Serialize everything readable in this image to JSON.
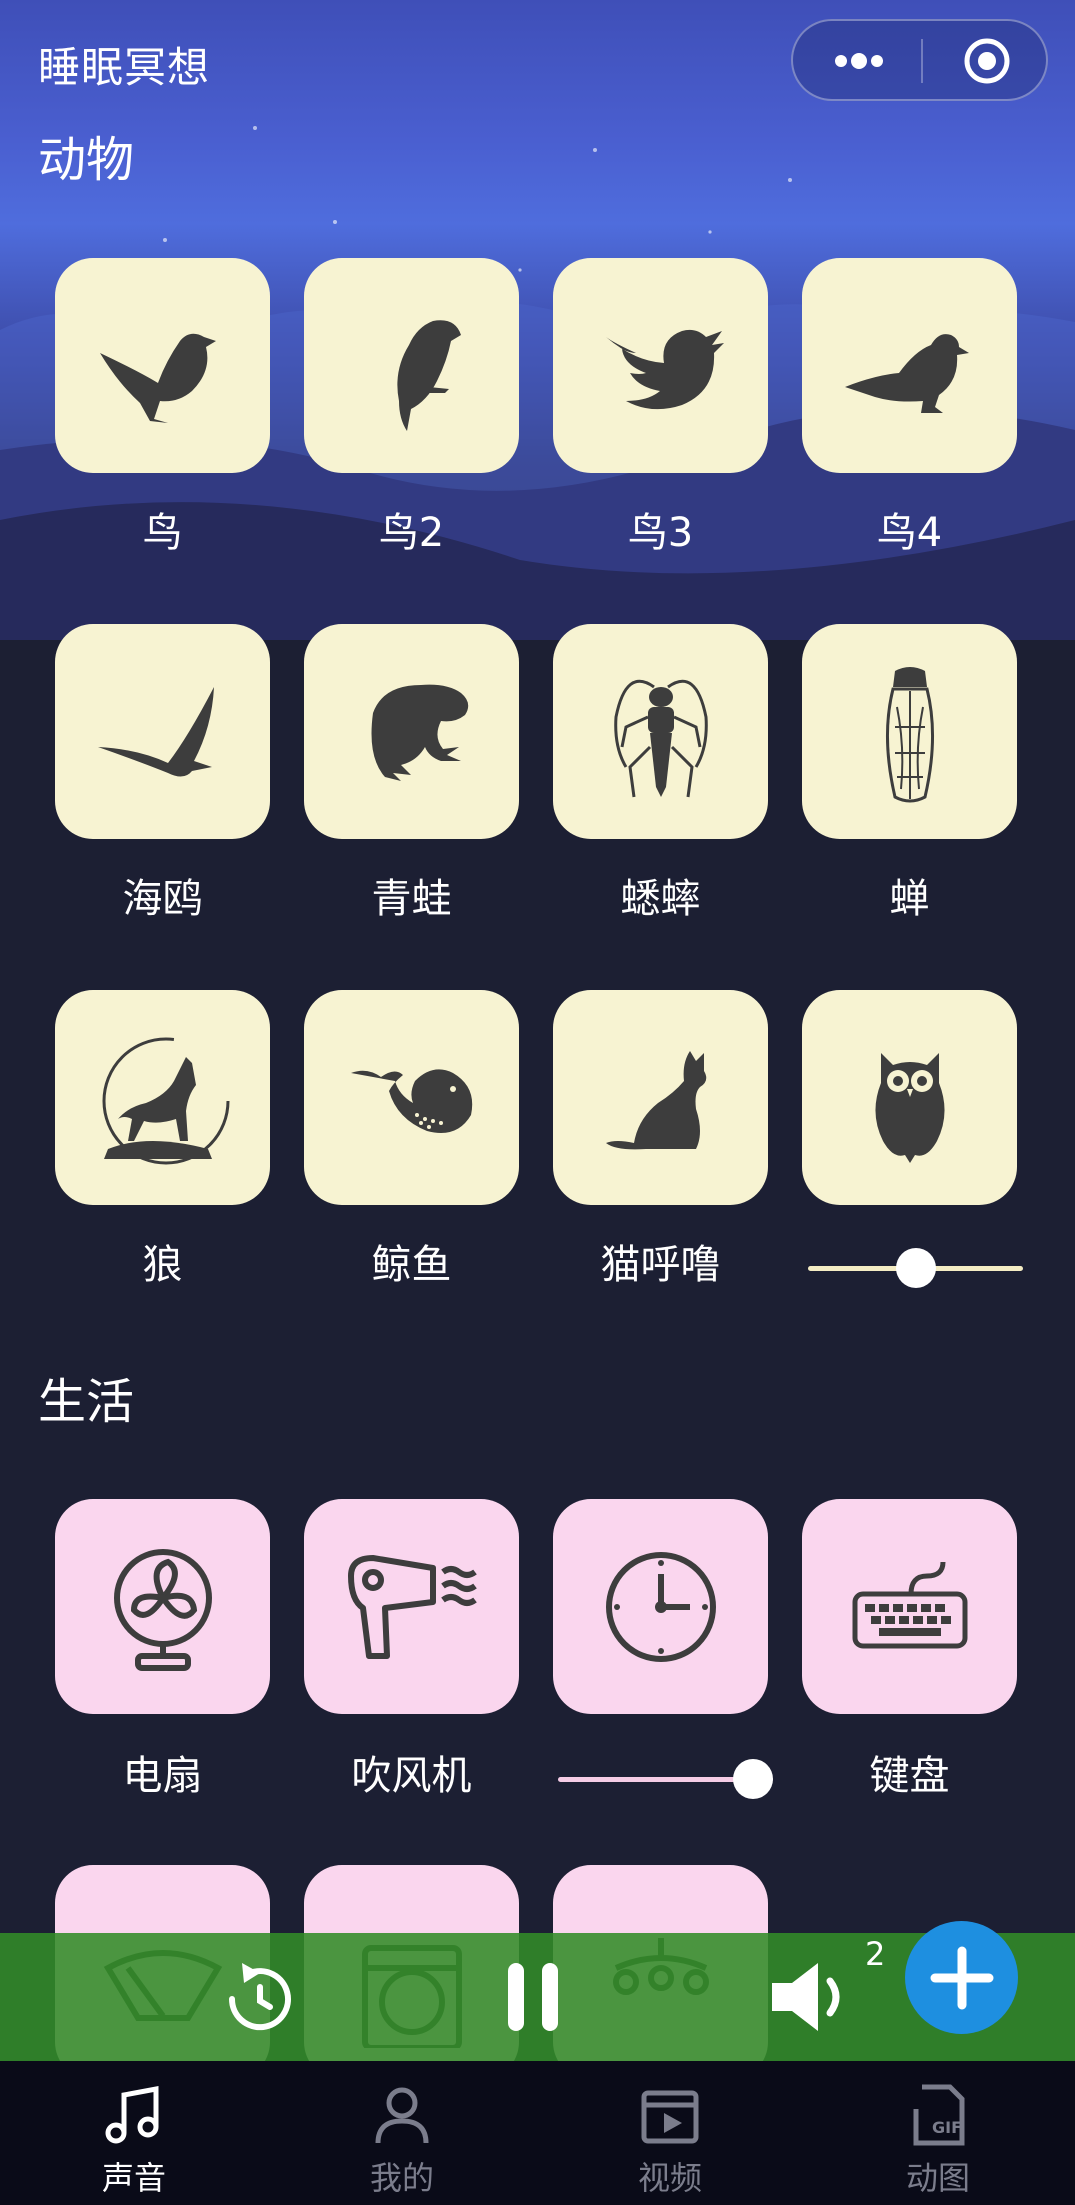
{
  "app": {
    "title": "睡眠冥想"
  },
  "capsule": {
    "more_icon": "more-dots-icon",
    "target_icon": "target-circle-icon"
  },
  "sections": {
    "animals": {
      "title": "动物",
      "items": [
        {
          "label": "鸟",
          "icon": "bird-icon"
        },
        {
          "label": "鸟2",
          "icon": "parrot-icon"
        },
        {
          "label": "鸟3",
          "icon": "twitter-bird-icon"
        },
        {
          "label": "鸟4",
          "icon": "pigeon-icon"
        },
        {
          "label": "海鸥",
          "icon": "seagull-icon"
        },
        {
          "label": "青蛙",
          "icon": "frog-icon"
        },
        {
          "label": "蟋蟀",
          "icon": "cricket-icon"
        },
        {
          "label": "蝉",
          "icon": "cicada-icon"
        },
        {
          "label": "狼",
          "icon": "wolf-icon"
        },
        {
          "label": "鲸鱼",
          "icon": "whale-icon"
        },
        {
          "label": "猫呼噜",
          "icon": "cat-icon"
        },
        {
          "label": "",
          "icon": "owl-icon"
        }
      ],
      "owl_volume": 0.5
    },
    "life": {
      "title": "生活",
      "items": [
        {
          "label": "电扇",
          "icon": "fan-icon"
        },
        {
          "label": "吹风机",
          "icon": "hair-dryer-icon"
        },
        {
          "label": "",
          "icon": "clock-icon"
        },
        {
          "label": "键盘",
          "icon": "keyboard-icon"
        }
      ],
      "clock_volume": 1.0
    }
  },
  "player": {
    "timer_icon": "timer-icon",
    "pause_icon": "pause-icon",
    "volume_icon": "volume-icon",
    "active_count": "2",
    "add_icon": "plus-icon",
    "background_tiles": [
      "wiper-icon",
      "washing-machine-icon",
      "wind-chime-icon"
    ]
  },
  "colors": {
    "animal_tile": "#f7f3d2",
    "life_tile": "#fad6ee",
    "player_bar": "#328c28",
    "fab": "#1e8fe0"
  },
  "tabs": [
    {
      "label": "声音",
      "icon": "music-note-icon",
      "active": true
    },
    {
      "label": "我的",
      "icon": "user-icon",
      "active": false
    },
    {
      "label": "视频",
      "icon": "video-icon",
      "active": false
    },
    {
      "label": "动图",
      "icon": "gif-file-icon",
      "active": false
    }
  ]
}
